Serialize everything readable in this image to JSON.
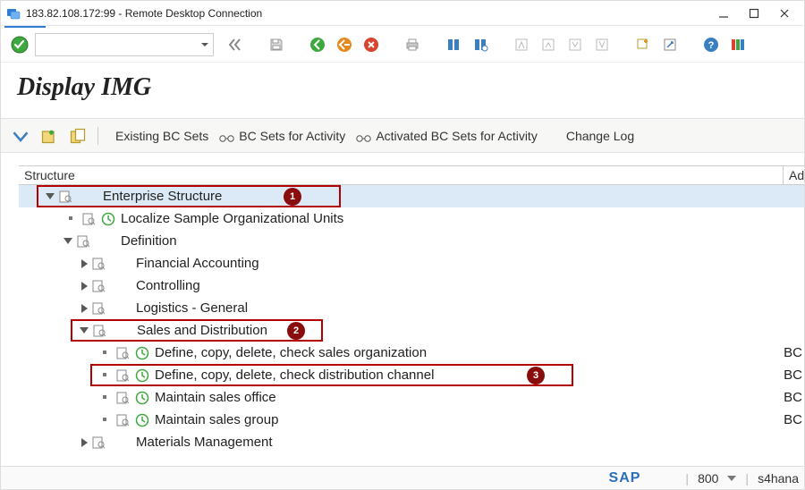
{
  "window": {
    "title": "183.82.108.172:99 - Remote Desktop Connection"
  },
  "heading": "Display IMG",
  "toolbar2": {
    "existing_bc_sets": "Existing BC Sets",
    "bc_sets_for_activity": "BC Sets for Activity",
    "activated_bc_sets": "Activated BC Sets for Activity",
    "change_log": "Change Log"
  },
  "panel": {
    "col_structure": "Structure",
    "col_additional": "Ad"
  },
  "tree": {
    "n0": "Enterprise Structure",
    "n1": "Localize Sample Organizational Units",
    "n2": "Definition",
    "n3": "Financial Accounting",
    "n4": "Controlling",
    "n5": "Logistics - General",
    "n6": "Sales and Distribution",
    "n7": "Define, copy, delete, check sales organization",
    "n8": "Define, copy, delete, check distribution channel",
    "n9": "Maintain sales office",
    "n10": "Maintain sales group",
    "n11": "Materials Management",
    "right_bc": "BC"
  },
  "badges": {
    "b1": "1",
    "b2": "2",
    "b3": "3"
  },
  "footer": {
    "sap": "SAP",
    "zoom": "800",
    "client": "s4hana"
  }
}
